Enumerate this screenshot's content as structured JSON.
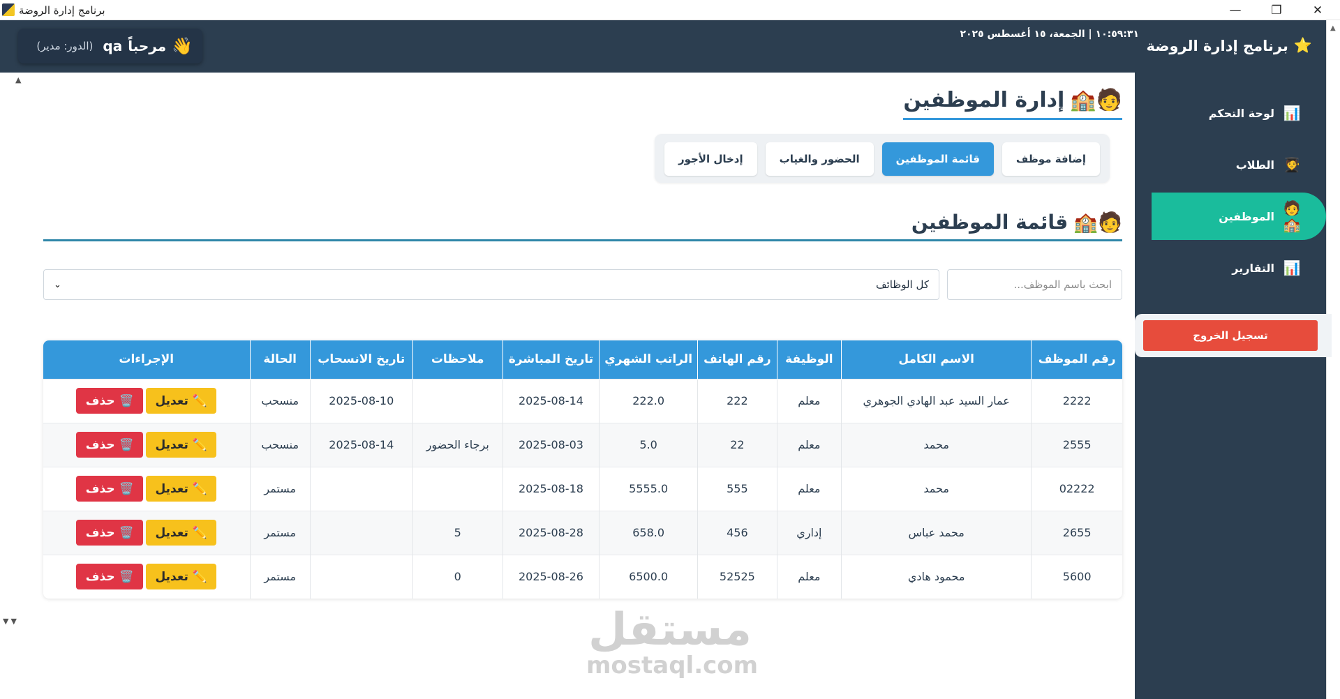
{
  "window": {
    "title": "برنامج إدارة الروضة",
    "min": "—",
    "restore": "❐",
    "close": "✕"
  },
  "header": {
    "app_name": "برنامج إدارة الروضة",
    "app_icon": "⭐",
    "datetime": "١٠:٥٩:٣١   |   الجمعة، ١٥ أغسطس ٢٠٢٥",
    "wave_icon": "👋",
    "welcome": "مرحباً",
    "username": "qa",
    "role": "(الدور: مدير)"
  },
  "sidebar": {
    "items": [
      {
        "icon": "📊",
        "label": "لوحة التحكم"
      },
      {
        "icon": "🧑‍🎓",
        "label": "الطلاب"
      },
      {
        "icon": "🧑🏫",
        "label": "الموظفين"
      },
      {
        "icon": "📊",
        "label": "التقارير"
      }
    ],
    "logout": "تسجيل الخروج"
  },
  "main": {
    "page_title": "إدارة الموظفين",
    "page_title_icon": "🧑🏫",
    "tabs": [
      {
        "label": "إضافة موظف"
      },
      {
        "label": "قائمة الموظفين"
      },
      {
        "label": "الحضور والغياب"
      },
      {
        "label": "إدخال الأجور"
      }
    ],
    "section_title": "قائمة الموظفين",
    "section_title_icon": "🧑🏫",
    "search_placeholder": "ابحث باسم الموظف...",
    "filter_value": "كل الوظائف",
    "filter_chev": "⌄",
    "table": {
      "columns": [
        "رقم الموظف",
        "الاسم الكامل",
        "الوظيفة",
        "رقم الهاتف",
        "الراتب الشهري",
        "تاريخ المباشرة",
        "ملاحظات",
        "تاريخ الانسحاب",
        "الحالة",
        "الإجراءات"
      ],
      "edit_label": "تعديل",
      "edit_icon": "✏️",
      "delete_label": "حذف",
      "delete_icon": "🗑️",
      "rows": [
        {
          "id": "2222",
          "name": "عمار السيد عبد الهادي الجوهري",
          "job": "معلم",
          "phone": "222",
          "salary": "222.0",
          "start": "2025-08-14",
          "notes": "",
          "withdraw": "2025-08-10",
          "status": "منسحب"
        },
        {
          "id": "2555",
          "name": "محمد",
          "job": "معلم",
          "phone": "22",
          "salary": "5.0",
          "start": "2025-08-03",
          "notes": "برجاء الحضور",
          "withdraw": "2025-08-14",
          "status": "منسحب"
        },
        {
          "id": "02222",
          "name": "محمد",
          "job": "معلم",
          "phone": "555",
          "salary": "5555.0",
          "start": "2025-08-18",
          "notes": "",
          "withdraw": "",
          "status": "مستمر"
        },
        {
          "id": "2655",
          "name": "محمد عباس",
          "job": "إداري",
          "phone": "456",
          "salary": "658.0",
          "start": "2025-08-28",
          "notes": "5",
          "withdraw": "",
          "status": "مستمر"
        },
        {
          "id": "5600",
          "name": "محمود هادي",
          "job": "معلم",
          "phone": "52525",
          "salary": "6500.0",
          "start": "2025-08-26",
          "notes": "0",
          "withdraw": "",
          "status": "مستمر"
        }
      ]
    }
  },
  "watermark": {
    "arabic": "مستقل",
    "latin": "mostaql.com"
  }
}
